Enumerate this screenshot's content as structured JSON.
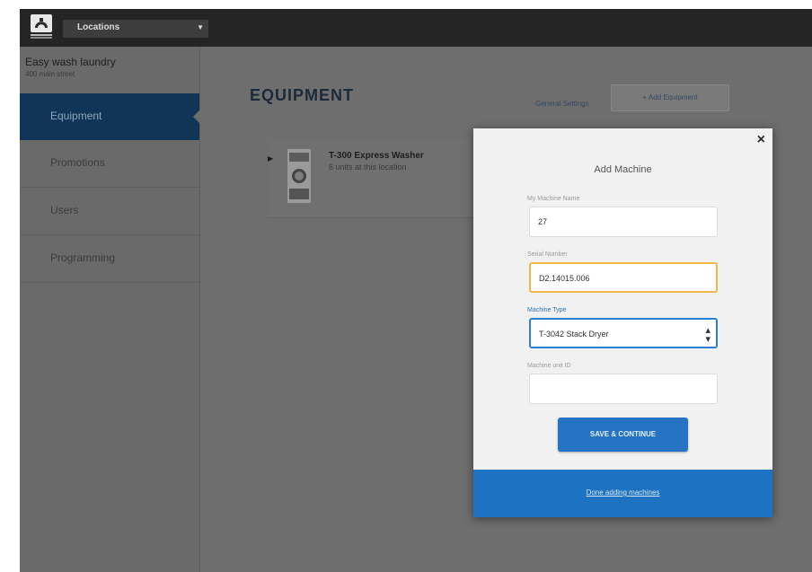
{
  "topbar": {
    "location_select_value": "Locations"
  },
  "sidebar": {
    "location_name": "Easy wash laundry",
    "location_address": "400 main street",
    "items": [
      {
        "label": "Equipment",
        "active": true
      },
      {
        "label": "Promotions",
        "active": false
      },
      {
        "label": "Users",
        "active": false
      },
      {
        "label": "Programming",
        "active": false
      }
    ]
  },
  "main": {
    "title": "EQUIPMENT",
    "general_settings_link": "General Settings",
    "add_equipment_button": "+ Add Equipment",
    "equipment_card": {
      "name": "T-300 Express Washer",
      "subtitle": "6 units at this location"
    }
  },
  "modal": {
    "title": "Add Machine",
    "close_icon": "close-icon",
    "fields": {
      "machine_name": {
        "label": "My Machine Name",
        "value": "27"
      },
      "serial_number": {
        "label": "Serial Number",
        "value": "D2.14015.006"
      },
      "machine_type": {
        "label": "Machine Type",
        "value": "T-3042 Stack Dryer"
      },
      "machine_id": {
        "label": "Machine unit ID",
        "value": ""
      }
    },
    "save_button": "SAVE & CONTINUE",
    "done_link": "Done adding machines"
  },
  "colors": {
    "topbar": "#252525",
    "sidebar_active": "#103557",
    "primary_blue": "#2474c3",
    "footer_blue": "#1d72c1",
    "focus_border": "#efb84a"
  }
}
